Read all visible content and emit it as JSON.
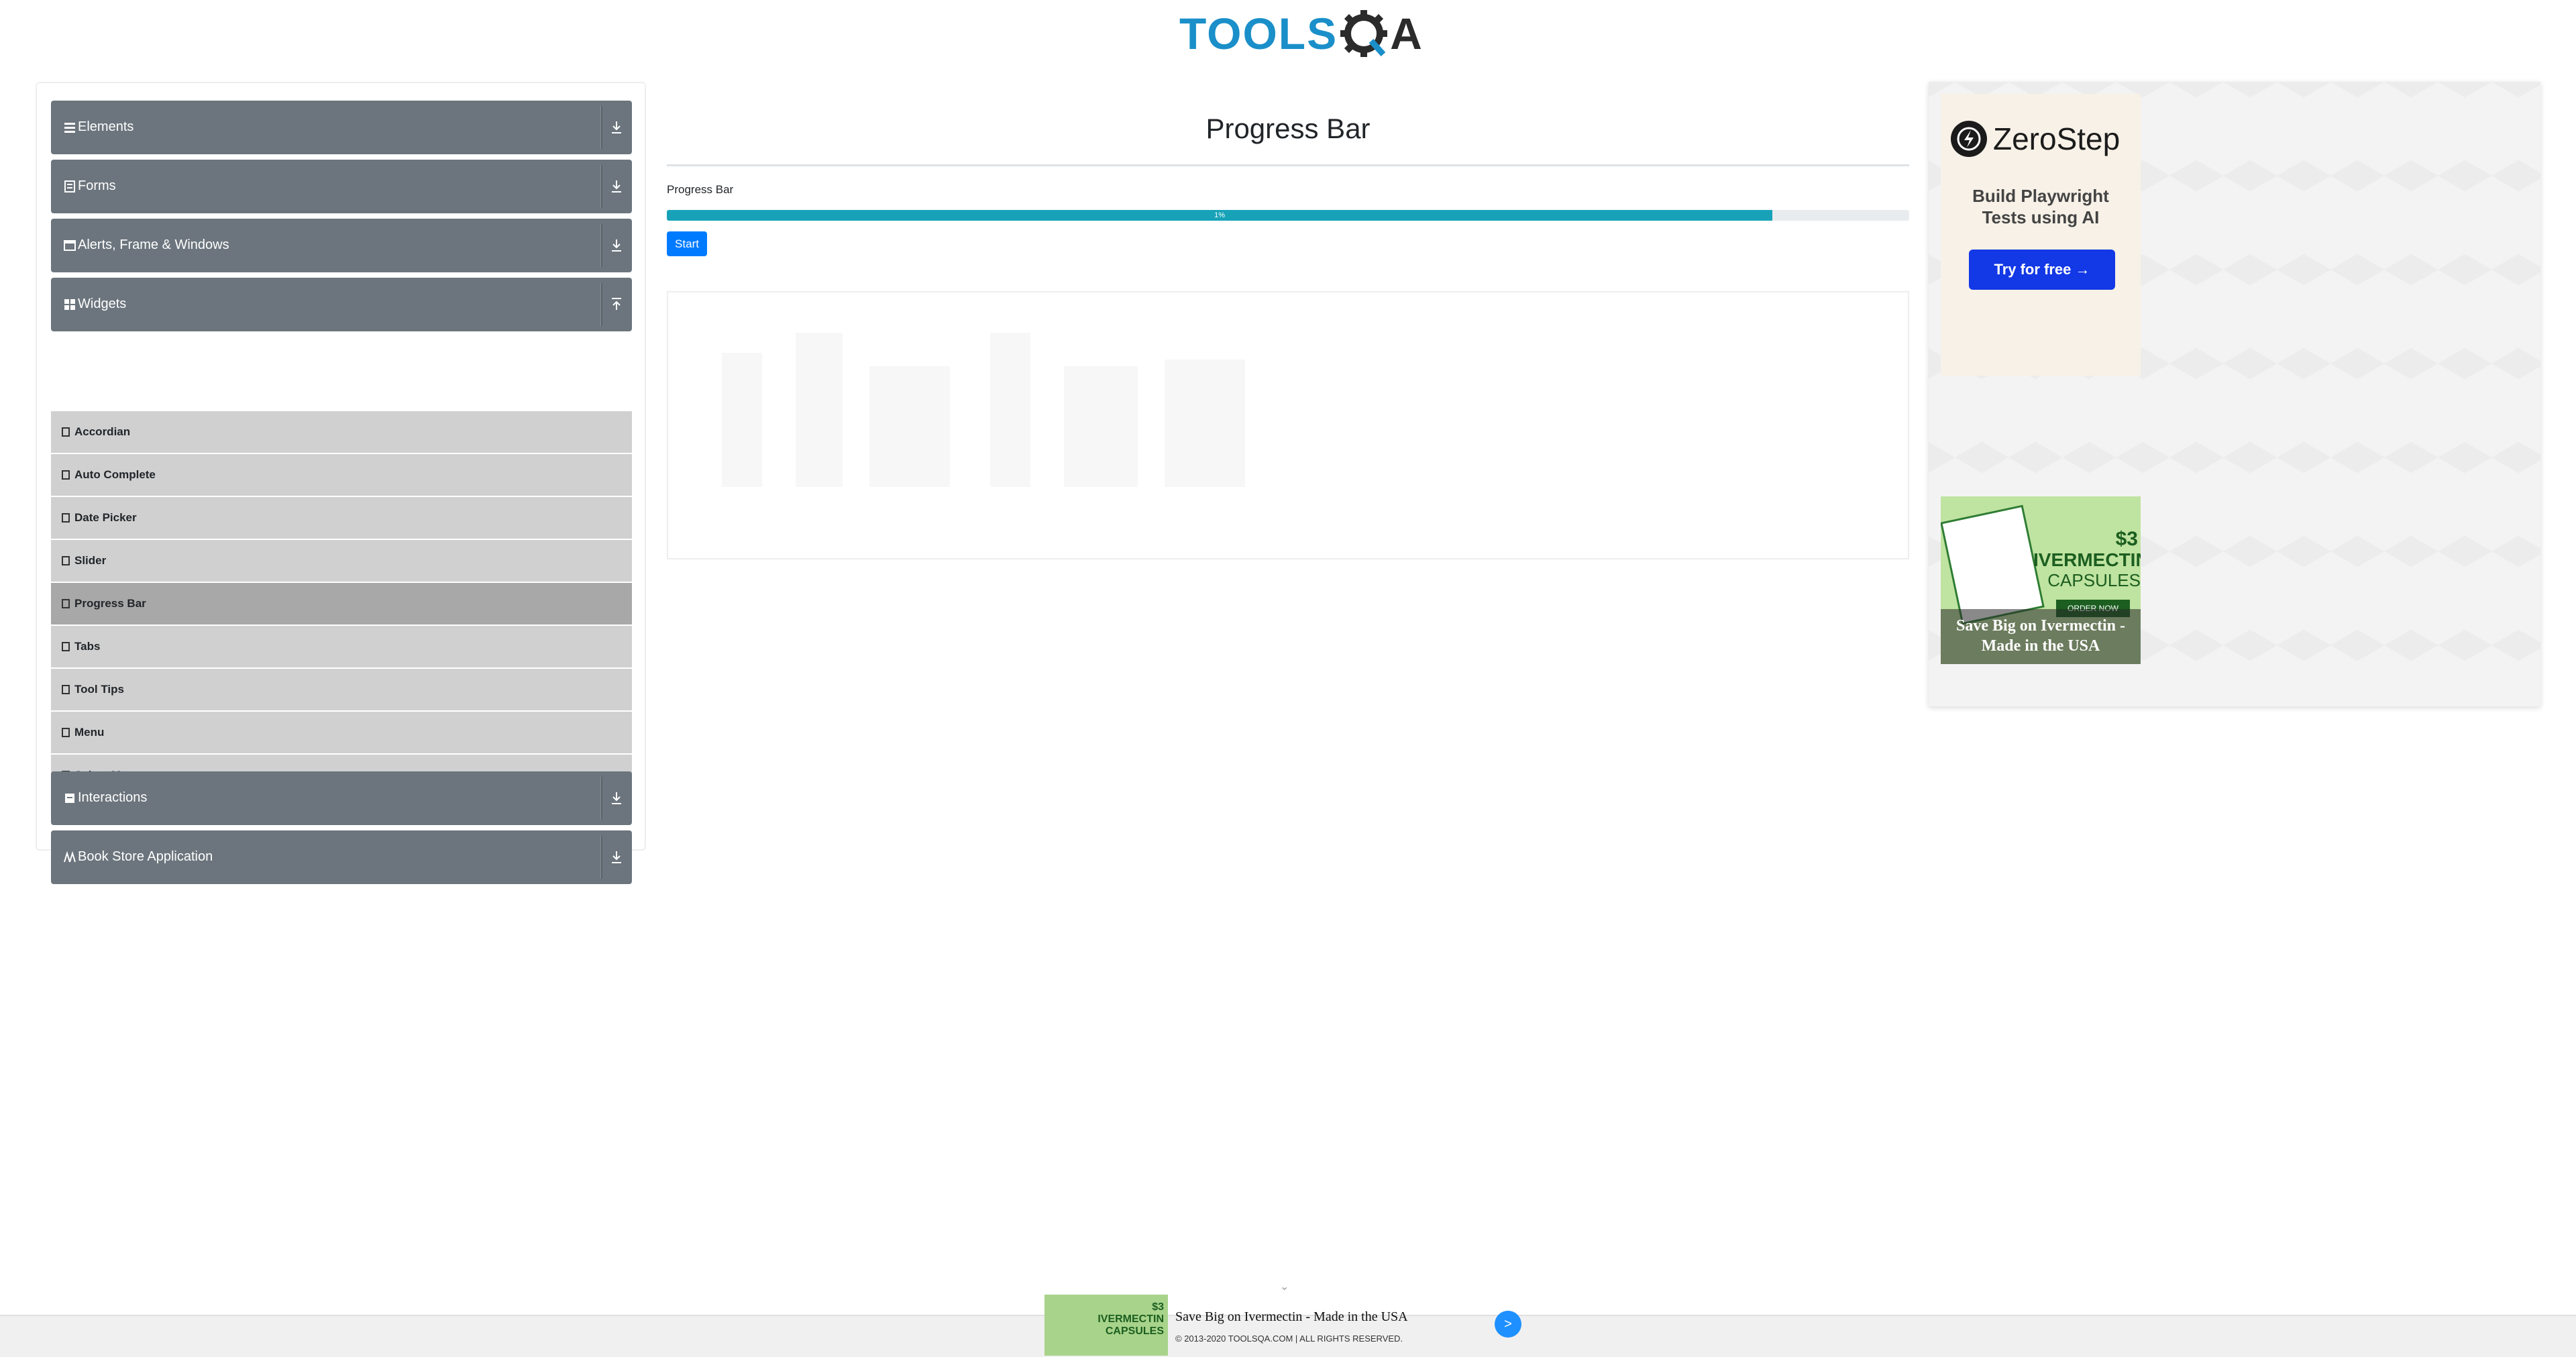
{
  "header": {
    "logo_part1": "TOOLS",
    "logo_part2": "A"
  },
  "sidebar": {
    "groups": [
      {
        "label": "Elements",
        "icon": "list-icon"
      },
      {
        "label": "Forms",
        "icon": "form-icon"
      },
      {
        "label": "Alerts, Frame & Windows",
        "icon": "window-icon"
      },
      {
        "label": "Widgets",
        "icon": "grid-icon"
      },
      {
        "label": "Interactions",
        "icon": "interaction-icon"
      },
      {
        "label": "Book Store Application",
        "icon": "book-icon"
      }
    ],
    "widget_items": [
      "Accordian",
      "Auto Complete",
      "Date Picker",
      "Slider",
      "Progress Bar",
      "Tabs",
      "Tool Tips",
      "Menu",
      "Select Menu"
    ],
    "active_item": "Progress Bar"
  },
  "main": {
    "title": "Progress Bar",
    "progress_label": "Progress Bar",
    "progress_value": 89,
    "progress_text": "1%",
    "start_label": "Start"
  },
  "right_ad": {
    "brand": "ZeroStep",
    "tagline_line1": "Build Playwright",
    "tagline_line2": "Tests using AI",
    "cta": "Try for free →",
    "ivm_price": "$3",
    "ivm_name": "IVERMECTIN",
    "ivm_sub": "CAPSULES",
    "ivm_order": "ORDER NOW",
    "ivm_caption": "Save Big on Ivermectin - Made in the USA"
  },
  "footer": {
    "copyright": "© 2013-2020 TOOLSQA.COM | ALL RIGHTS RESERVED.",
    "ad_text": "Save Big on Ivermectin - Made in the USA",
    "ad_img_price": "$3",
    "ad_img_name": "IVERMECTIN",
    "ad_img_sub": "CAPSULES",
    "next_label": ">"
  },
  "colors": {
    "brand_blue": "#1a8fc9",
    "sidebar_gray": "#6c757d",
    "progress": "#17a2b8",
    "primary": "#007bff"
  }
}
